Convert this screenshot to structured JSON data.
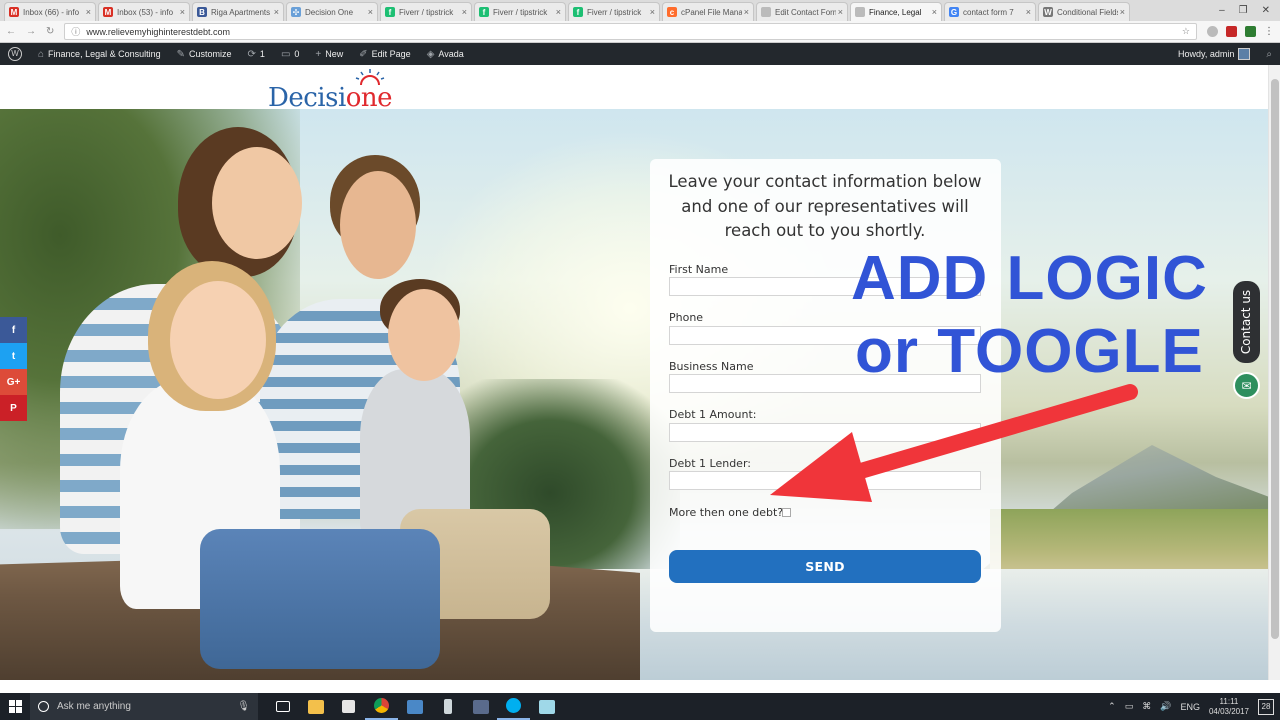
{
  "browser": {
    "tabs": [
      {
        "title": "Inbox (66) - info",
        "favicon": "gmail-icon",
        "color": "#d93025",
        "glyph": "M"
      },
      {
        "title": "Inbox (53) - info",
        "favicon": "gmail-icon",
        "color": "#d93025",
        "glyph": "M"
      },
      {
        "title": "Riga Apartments",
        "favicon": "blogger-icon",
        "color": "#3b5998",
        "glyph": "B"
      },
      {
        "title": "Decision One",
        "favicon": "puzzle-icon",
        "color": "#6aa0d8",
        "glyph": "✣"
      },
      {
        "title": "Fiverr / tipstrick",
        "favicon": "fiverr-icon",
        "color": "#1dbf73",
        "glyph": "f"
      },
      {
        "title": "Fiverr / tipstrick",
        "favicon": "fiverr-icon",
        "color": "#1dbf73",
        "glyph": "f"
      },
      {
        "title": "Fiverr / tipstrick",
        "favicon": "fiverr-icon",
        "color": "#1dbf73",
        "glyph": "f"
      },
      {
        "title": "cPanel File Manager",
        "favicon": "cpanel-icon",
        "color": "#ff6c2c",
        "glyph": "c"
      },
      {
        "title": "Edit Contact Form",
        "favicon": "page-icon",
        "color": "#bbbbbb",
        "glyph": ""
      },
      {
        "title": "Finance, Legal",
        "favicon": "page-icon",
        "color": "#bbbbbb",
        "glyph": "",
        "active": true
      },
      {
        "title": "contact form 7",
        "favicon": "google-icon",
        "color": "#4285f4",
        "glyph": "G"
      },
      {
        "title": "Conditional Fields",
        "favicon": "wordpress-icon",
        "color": "#777777",
        "glyph": "W"
      }
    ],
    "url": "www.relievemyhighinterestdebt.com"
  },
  "wp_admin_bar": {
    "site_name": "Finance, Legal & Consulting",
    "customize": "Customize",
    "updates_count": "1",
    "comments_count": "0",
    "new": "New",
    "edit_page": "Edit Page",
    "avada": "Avada",
    "howdy": "Howdy, admin"
  },
  "site": {
    "logo_main": "Decisi",
    "logo_accent": "one",
    "intro": "Leave your contact information below and one of our representatives will reach out to you shortly.",
    "fields": [
      {
        "label": "First Name",
        "value": ""
      },
      {
        "label": "Phone",
        "value": ""
      },
      {
        "label": "Business Name",
        "value": ""
      },
      {
        "label": "Debt 1 Amount:",
        "value": ""
      },
      {
        "label": "Debt 1 Lender:",
        "value": ""
      }
    ],
    "checkbox_label": "More then one debt?",
    "checkbox_checked": false,
    "send_label": "SEND",
    "contact_tab": "Contact us"
  },
  "annotation": {
    "line1": "ADD LOGIC",
    "line2": "or TOOGLE",
    "color": "#3154d6",
    "arrow_color": "#f0353a"
  },
  "share_buttons": [
    {
      "name": "facebook-share-icon",
      "glyph": "f",
      "color": "#3b5998"
    },
    {
      "name": "twitter-share-icon",
      "glyph": "t",
      "color": "#1da1f2"
    },
    {
      "name": "google-plus-share-icon",
      "glyph": "G+",
      "color": "#dd4b39"
    },
    {
      "name": "pinterest-share-icon",
      "glyph": "P",
      "color": "#cb2027"
    }
  ],
  "taskbar": {
    "search_placeholder": "Ask me anything",
    "language": "ENG",
    "time": "11:11",
    "date": "04/03/2017",
    "notifications": "28"
  }
}
